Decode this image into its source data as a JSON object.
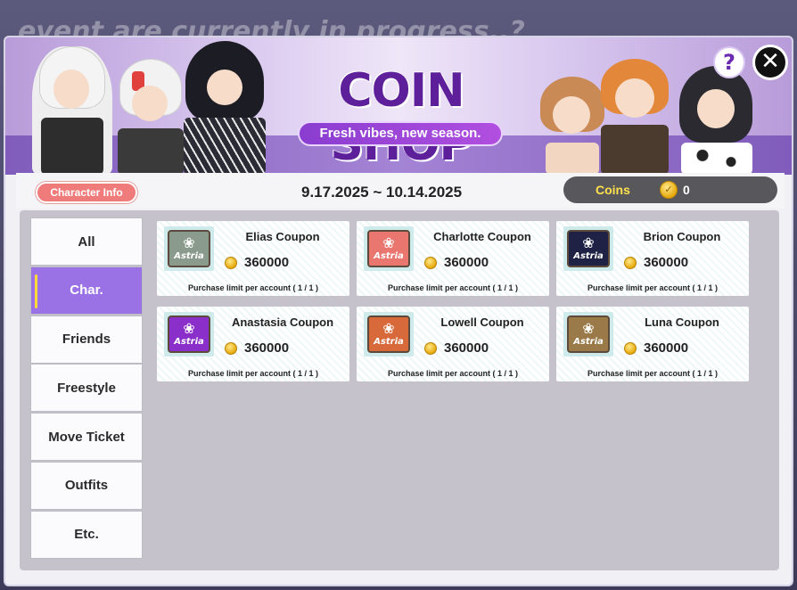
{
  "background": {
    "text": "event are currently in progress..?"
  },
  "banner": {
    "title": "COIN SHOP",
    "subtitle": "Fresh vibes, new season."
  },
  "controls": {
    "help": "?",
    "close": "✕"
  },
  "info": {
    "character_info": "Character Info",
    "date_range": "9.17.2025 ~ 10.14.2025",
    "coins_label": "Coins",
    "coins_value": "0"
  },
  "tabs": [
    {
      "label": "All",
      "active": false
    },
    {
      "label": "Char.",
      "active": true
    },
    {
      "label": "Friends",
      "active": false
    },
    {
      "label": "Freestyle",
      "active": false
    },
    {
      "label": "Move Ticket",
      "active": false
    },
    {
      "label": "Outfits",
      "active": false
    },
    {
      "label": "Etc.",
      "active": false
    }
  ],
  "items": [
    {
      "name": "Elias Coupon",
      "price": "360000",
      "limit": "Purchase limit per account ( 1 / 1 )",
      "brand": "Astria",
      "icon_color": "#8a9a8c"
    },
    {
      "name": "Charlotte Coupon",
      "price": "360000",
      "limit": "Purchase limit per account ( 1 / 1 )",
      "brand": "Astria",
      "icon_color": "#e9776f"
    },
    {
      "name": "Brion Coupon",
      "price": "360000",
      "limit": "Purchase limit per account ( 1 / 1 )",
      "brand": "Astria",
      "icon_color": "#1f2244"
    },
    {
      "name": "Anastasia Coupon",
      "price": "360000",
      "limit": "Purchase limit per account ( 1 / 1 )",
      "brand": "Astria",
      "icon_color": "#8a2fc9"
    },
    {
      "name": "Lowell Coupon",
      "price": "360000",
      "limit": "Purchase limit per account ( 1 / 1 )",
      "brand": "Astria",
      "icon_color": "#d7693a"
    },
    {
      "name": "Luna Coupon",
      "price": "360000",
      "limit": "Purchase limit per account ( 1 / 1 )",
      "brand": "Astria",
      "icon_color": "#9a7a48"
    }
  ],
  "colors": {
    "title": "#5e1f9a",
    "accent_tab": "#9a72e6",
    "coins_label": "#ffe14d"
  }
}
